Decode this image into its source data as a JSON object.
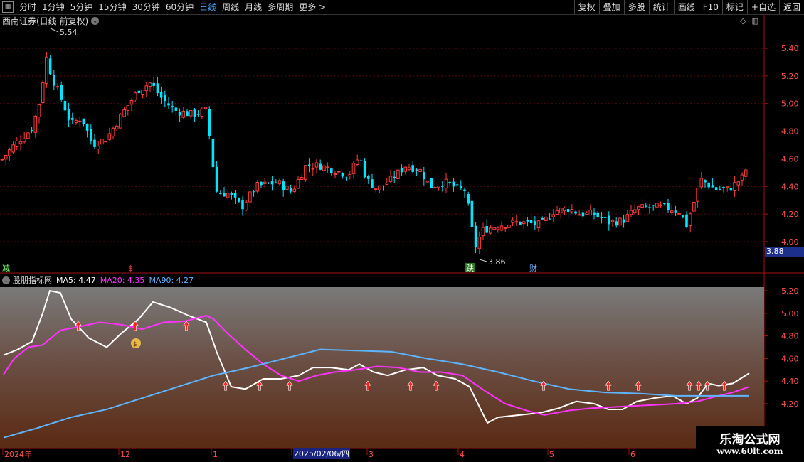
{
  "toolbar": {
    "left": [
      {
        "label": "分时",
        "active": false
      },
      {
        "label": "1分钟",
        "active": false
      },
      {
        "label": "5分钟",
        "active": false
      },
      {
        "label": "15分钟",
        "active": false
      },
      {
        "label": "30分钟",
        "active": false
      },
      {
        "label": "60分钟",
        "active": false
      },
      {
        "label": "日线",
        "active": true
      },
      {
        "label": "周线",
        "active": false
      },
      {
        "label": "月线",
        "active": false
      },
      {
        "label": "多周期",
        "active": false
      },
      {
        "label": "更多 >",
        "active": false
      }
    ],
    "right": [
      "复权",
      "叠加",
      "多股",
      "统计",
      "画线",
      "F10",
      "标记",
      "+自选",
      "返回"
    ]
  },
  "stock_title": "西南证券(日线 前复权)",
  "last_price_badge": "3.88",
  "main_chart": {
    "high_label": "5.54",
    "low_label": "3.86",
    "y_ticks": [
      "5.40",
      "5.20",
      "5.00",
      "4.80",
      "4.60",
      "4.40",
      "4.20",
      "4.00"
    ],
    "markers": [
      "减",
      "$",
      "跌",
      "财"
    ]
  },
  "indicator": {
    "name": "股朋指标网",
    "ma5": "MA5: 4.47",
    "ma20": "MA20: 4.35",
    "ma90": "MA90: 4.27",
    "y_ticks": [
      "5.20",
      "5.00",
      "4.80",
      "4.60",
      "4.40",
      "4.20"
    ]
  },
  "x_axis": {
    "labels": [
      "2024年",
      "12",
      "1",
      "2",
      "3",
      "4",
      "5",
      "6"
    ],
    "cursor_date": "2025/02/06/四"
  },
  "watermark": {
    "line1": "乐淘公式网",
    "line2": "www.60lt.com"
  },
  "colors": {
    "up": "#ff3b3b",
    "down": "#00e5ff",
    "ma5": "#ffffff",
    "ma20": "#ff33ff",
    "ma90": "#5fb4ff"
  }
}
